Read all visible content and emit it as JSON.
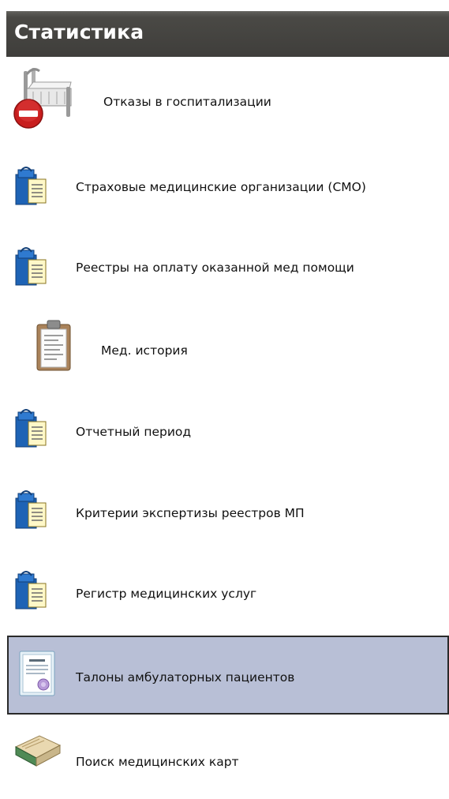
{
  "panel": {
    "title": "Статистика"
  },
  "items": [
    {
      "label": "Отказы в госпитализации",
      "icon": "hospital-bed-refusal-icon",
      "selected": false
    },
    {
      "label": "Страховые медицинские организации (СМО)",
      "icon": "handbook-book-icon",
      "selected": false
    },
    {
      "label": "Реестры на оплату оказанной мед помощи",
      "icon": "handbook-book-icon",
      "selected": false
    },
    {
      "label": "Мед. история",
      "icon": "clipboard-icon",
      "selected": false
    },
    {
      "label": "Отчетный период",
      "icon": "handbook-book-icon",
      "selected": false
    },
    {
      "label": "Критерии экспертизы реестров МП",
      "icon": "handbook-book-icon",
      "selected": false
    },
    {
      "label": "Регистр медицинских услуг",
      "icon": "handbook-book-icon",
      "selected": false
    },
    {
      "label": "Талоны амбулаторных пациентов",
      "icon": "ticket-document-icon",
      "selected": true
    },
    {
      "label": "Поиск медицинских карт",
      "icon": "medical-card-book-icon",
      "selected": false
    }
  ],
  "colors": {
    "header_bg": "#3f3e3b",
    "selected_bg": "#b8bfd6",
    "selected_border": "#2a2a2a"
  }
}
